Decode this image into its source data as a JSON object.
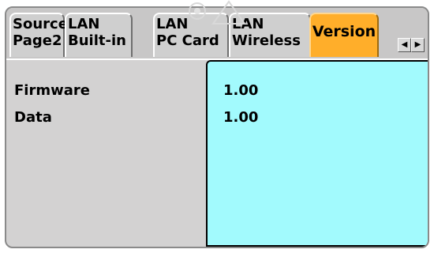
{
  "tabs": [
    {
      "line1": "Source",
      "line2": "Page2"
    },
    {
      "line1": "LAN",
      "line2": "Built-in"
    },
    {
      "line1": "LAN",
      "line2": "PC Card"
    },
    {
      "line1": "LAN",
      "line2": "Wireless"
    },
    {
      "label": "Version",
      "active": true
    }
  ],
  "scroll_buttons": {
    "left": "◀",
    "right": "▶"
  },
  "rows": [
    {
      "label": "Firmware",
      "value": "1.00"
    },
    {
      "label": "Data",
      "value": "1.00"
    }
  ],
  "colors": {
    "active_tab": "#ffae2a",
    "value_panel": "#a2fafd",
    "panel_background": "#d3d2d2"
  }
}
